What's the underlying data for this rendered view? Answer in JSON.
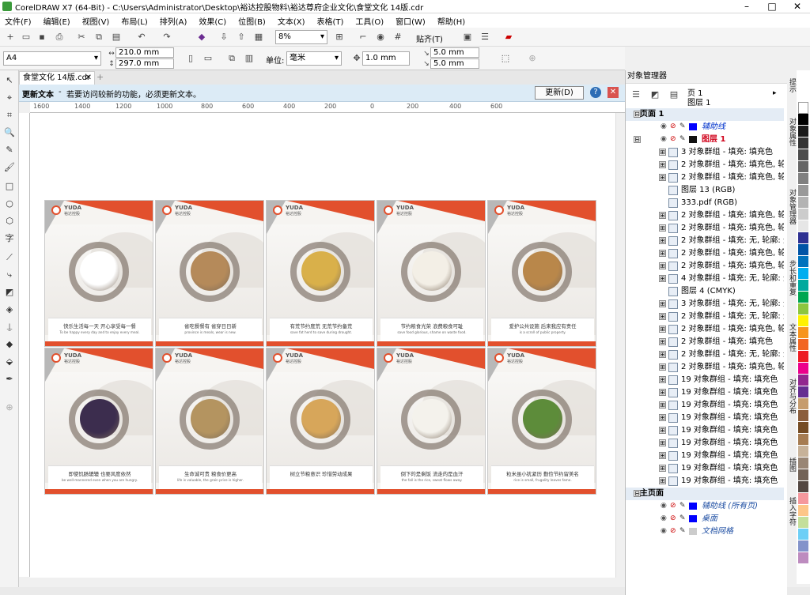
{
  "window": {
    "title": "CorelDRAW X7 (64-Bit) - C:\\Users\\Administrator\\Desktop\\裕达控股物料\\裕达尊府企业文化\\食堂文化 14版.cdr"
  },
  "menu": [
    "文件(F)",
    "编辑(E)",
    "视图(V)",
    "布局(L)",
    "排列(A)",
    "效果(C)",
    "位图(B)",
    "文本(X)",
    "表格(T)",
    "工具(O)",
    "窗口(W)",
    "帮助(H)"
  ],
  "toolbar": {
    "zoom": "8%",
    "snap": "贴齐(T)"
  },
  "propbar": {
    "page_size": "A4",
    "width": "210.0 mm",
    "height": "297.0 mm",
    "unit_label": "单位:",
    "unit": "毫米",
    "nudge": "1.0 mm",
    "dup_x": "5.0 mm",
    "dup_y": "5.0 mm"
  },
  "doc_tab": "食堂文化 14版.cdr",
  "notice": {
    "title": "更新文本",
    "message": "若要访问较新的功能，必须更新文本。",
    "button": "更新(D)"
  },
  "ruler": [
    "1600",
    "1400",
    "1200",
    "1000",
    "800",
    "600",
    "400",
    "200",
    "0",
    "200",
    "400",
    "600"
  ],
  "posters": [
    {
      "brand": "YUDA",
      "brand_cn": "裕达控股",
      "slogan": "快乐生活每一天 开心享受每一餐",
      "slogan_en": "To be happy every day and to enjoy every meal.",
      "food_color": "#ffffff"
    },
    {
      "brand": "YUDA",
      "brand_cn": "裕达控股",
      "slogan": "省吃餐餐有 省穿日日新",
      "slogan_en": "province is meals, wear is new.",
      "food_color": "#b58a5a"
    },
    {
      "brand": "YUDA",
      "brand_cn": "裕达控股",
      "slogan": "有荒节约度荒 无荒节约备荒",
      "slogan_en": "save fat herd to save during drought.",
      "food_color": "#d9b04a"
    },
    {
      "brand": "YUDA",
      "brand_cn": "裕达控股",
      "slogan": "节约粮食光荣 浪费粮食可耻",
      "slogan_en": "save food glorious, shame on waste food.",
      "food_color": "#f3efe6"
    },
    {
      "brand": "YUDA",
      "brand_cn": "裕达控股",
      "slogan": "爱护公共设施 后来我应有责任",
      "slogan_en": "is a scroll of public property.",
      "food_color": "#b9874a"
    },
    {
      "brand": "YUDA",
      "brand_cn": "裕达控股",
      "slogan": "即使饥肠辘辘 也要风度依然",
      "slogan_en": "be well-mannered even when you are hungry.",
      "food_color": "#3c2d4e"
    },
    {
      "brand": "YUDA",
      "brand_cn": "裕达控股",
      "slogan": "生命诚可贵 粮食价更高",
      "slogan_en": "life is valuable, the grain price is higher.",
      "food_color": "#b49460"
    },
    {
      "brand": "YUDA",
      "brand_cn": "裕达控股",
      "slogan": "树立节粮意识 珍惜劳动成果",
      "slogan_en": "",
      "food_color": "#d7a65a"
    },
    {
      "brand": "YUDA",
      "brand_cn": "裕达控股",
      "slogan": "倒下的是剩饭 流走的是血汗",
      "slogan_en": "the fall is the rice, sweat flows away.",
      "food_color": "#f4f2ec"
    },
    {
      "brand": "YUDA",
      "brand_cn": "裕达控股",
      "slogan": "粒米虽小犹紧历 勤俭节约留美名",
      "slogan_en": "rice is small, frugality leaves fame.",
      "food_color": "#5d8c3a"
    }
  ],
  "object_manager": {
    "title": "对象管理器",
    "page": "页 1",
    "layer": "图层 1",
    "rows": [
      {
        "text": "页面 1",
        "kind": "page"
      },
      {
        "text": "辅助线",
        "kind": "guide"
      },
      {
        "text": "图层 1",
        "kind": "layer"
      },
      {
        "text": "3 对象群组 - 填充: 填充色",
        "kind": "group"
      },
      {
        "text": "2 对象群组 - 填充: 填充色, 轮廓",
        "kind": "group"
      },
      {
        "text": "2 对象群组 - 填充: 填充色, 轮廓",
        "kind": "group"
      },
      {
        "text": "图层 13 (RGB)",
        "kind": "bitmap"
      },
      {
        "text": "333.pdf (RGB)",
        "kind": "bitmap"
      },
      {
        "text": "2 对象群组 - 填充: 填充色, 轮廓",
        "kind": "group"
      },
      {
        "text": "2 对象群组 - 填充: 填充色, 轮廓",
        "kind": "group"
      },
      {
        "text": "2 对象群组 - 填充: 无, 轮廓: 无",
        "kind": "group"
      },
      {
        "text": "2 对象群组 - 填充: 填充色, 轮廓",
        "kind": "group"
      },
      {
        "text": "2 对象群组 - 填充: 填充色, 轮廓",
        "kind": "group"
      },
      {
        "text": "4 对象群组 - 填充: 无, 轮廓: 无",
        "kind": "group"
      },
      {
        "text": "图层 4 (CMYK)",
        "kind": "bitmap"
      },
      {
        "text": "3 对象群组 - 填充: 无, 轮廓: 无",
        "kind": "group"
      },
      {
        "text": "2 对象群组 - 填充: 无, 轮廓: 无",
        "kind": "group"
      },
      {
        "text": "2 对象群组 - 填充: 填充色, 轮廓",
        "kind": "group"
      },
      {
        "text": "2 对象群组 - 填充: 填充色",
        "kind": "group"
      },
      {
        "text": "2 对象群组 - 填充: 无, 轮廓: 无",
        "kind": "group"
      },
      {
        "text": "2 对象群组 - 填充: 填充色, 轮廓",
        "kind": "group"
      },
      {
        "text": "19 对象群组 - 填充: 填充色",
        "kind": "group"
      },
      {
        "text": "19 对象群组 - 填充: 填充色",
        "kind": "group"
      },
      {
        "text": "19 对象群组 - 填充: 填充色",
        "kind": "group"
      },
      {
        "text": "19 对象群组 - 填充: 填充色",
        "kind": "group"
      },
      {
        "text": "19 对象群组 - 填充: 填充色",
        "kind": "group"
      },
      {
        "text": "19 对象群组 - 填充: 填充色",
        "kind": "group"
      },
      {
        "text": "19 对象群组 - 填充: 填充色",
        "kind": "group"
      },
      {
        "text": "19 对象群组 - 填充: 填充色",
        "kind": "group"
      },
      {
        "text": "19 对象群组 - 填充: 填充色",
        "kind": "group"
      },
      {
        "text": "主页面",
        "kind": "page"
      },
      {
        "text": "辅助线 (所有页)",
        "kind": "master"
      },
      {
        "text": "桌面",
        "kind": "master"
      },
      {
        "text": "文档网格",
        "kind": "master"
      }
    ]
  },
  "docker_tabs": [
    "提示",
    "对象属性",
    "对象管理器",
    "步长和重复",
    "文本属性",
    "对齐与分布",
    "插图",
    "插入字符"
  ],
  "palette": [
    "#ffffff",
    "#000000",
    "#1a1a1a",
    "#333333",
    "#4d4d4d",
    "#666666",
    "#808080",
    "#999999",
    "#b3b3b3",
    "#cccccc",
    "#e6e6e6",
    "#2e3192",
    "#0054a6",
    "#0072bc",
    "#00aeef",
    "#00a99d",
    "#00a651",
    "#8dc63f",
    "#fff200",
    "#f7941d",
    "#f26522",
    "#ed1c24",
    "#ec008c",
    "#92278f",
    "#662d91",
    "#c69c6d",
    "#8b5e3c",
    "#754c24",
    "#a67c52",
    "#c7b299",
    "#998675",
    "#736357",
    "#534741",
    "#f5989d",
    "#fdc689",
    "#c4df9b",
    "#6dcff6",
    "#8393ca",
    "#bd8cbf"
  ]
}
